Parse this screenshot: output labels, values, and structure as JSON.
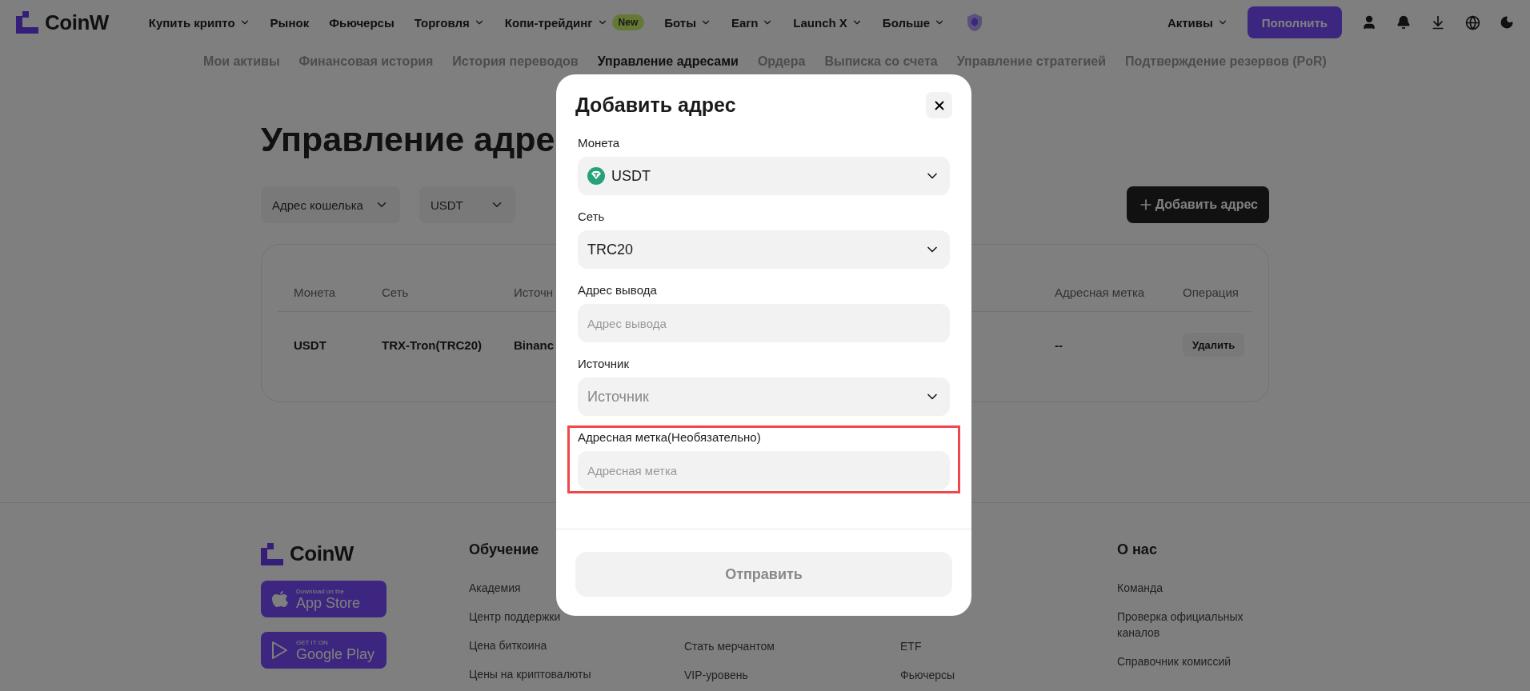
{
  "header": {
    "logo": "CoinW",
    "nav": [
      {
        "label": "Купить крипто",
        "has_menu": true
      },
      {
        "label": "Рынок",
        "has_menu": false
      },
      {
        "label": "Фьючерсы",
        "has_menu": false
      },
      {
        "label": "Торговля",
        "has_menu": true
      },
      {
        "label": "Копи-трейдинг",
        "has_menu": true,
        "badge": "New"
      },
      {
        "label": "Боты",
        "has_menu": true
      },
      {
        "label": "Earn",
        "has_menu": true
      },
      {
        "label": "Launch X",
        "has_menu": true
      },
      {
        "label": "Больше",
        "has_menu": true
      }
    ],
    "assets": "Активы",
    "deposit": "Пополнить"
  },
  "subnav": [
    {
      "label": "Мои активы",
      "selected": false
    },
    {
      "label": "Финансовая история",
      "selected": false
    },
    {
      "label": "История переводов",
      "selected": false
    },
    {
      "label": "Управление адресами",
      "selected": true
    },
    {
      "label": "Ордера",
      "selected": false
    },
    {
      "label": "Выписка со счета",
      "selected": false
    },
    {
      "label": "Управление стратегией",
      "selected": false
    },
    {
      "label": "Подтверждение резервов (PoR)",
      "selected": false
    }
  ],
  "page": {
    "title": "Управление адре",
    "filters": [
      "Адрес кошелька",
      "USDT"
    ],
    "add_button": "Добавить адрес",
    "table": {
      "columns": [
        "Монета",
        "Сеть",
        "Источн",
        "Адресная метка",
        "Операция"
      ],
      "rows": [
        {
          "cells": [
            "USDT",
            "TRX-Tron(TRC20)",
            "Binanc",
            "--"
          ],
          "action": "Удалить"
        }
      ]
    }
  },
  "footer": {
    "logo": "CoinW",
    "stores": [
      {
        "kind": "apple",
        "small": "Download on the",
        "big": "App Store"
      },
      {
        "kind": "google",
        "small": "GET IT ON",
        "big": "Google Play"
      }
    ],
    "columns": [
      {
        "heading": "Обучение",
        "links": [
          "Академия",
          "Центр поддержки",
          "Цена биткоина",
          "Цены на криптовалюты"
        ]
      },
      {
        "links": [
          "Стать мерчантом",
          "VIP-уровень"
        ]
      },
      {
        "links": [
          "ETF",
          "Фьючерсы"
        ]
      },
      {
        "heading": "О нас",
        "links": [
          "Команда",
          "Проверка официальных каналов",
          "Справочник комиссий"
        ]
      }
    ]
  },
  "modal": {
    "title": "Добавить адрес",
    "fields": [
      {
        "kind": "select",
        "label": "Монета",
        "value": "USDT",
        "coin_icon": true,
        "highlighted": false
      },
      {
        "kind": "select",
        "label": "Сеть",
        "value": "TRC20",
        "highlighted": false
      },
      {
        "kind": "input",
        "label": "Адрес вывода",
        "placeholder": "Адрес вывода",
        "highlighted": false
      },
      {
        "kind": "select",
        "label": "Источник",
        "placeholder": "Источник",
        "highlighted": false
      },
      {
        "kind": "input",
        "label": "Адресная метка(Необязательно)",
        "placeholder": "Адресная метка",
        "highlighted": true
      }
    ],
    "submit": {
      "label": "Отправить",
      "disabled": true
    }
  }
}
